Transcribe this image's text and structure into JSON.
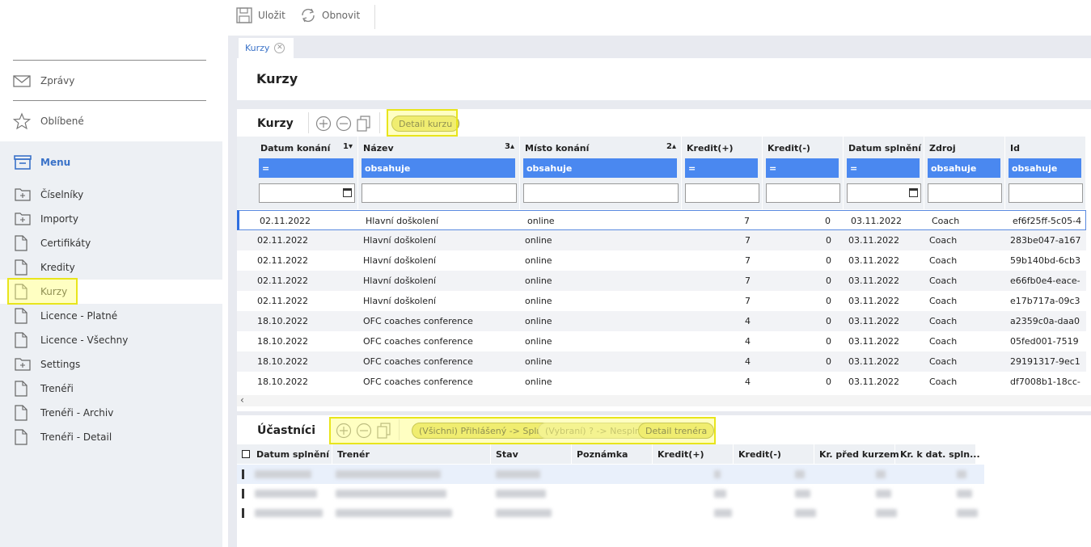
{
  "toolbar": {
    "save_label": "Uložit",
    "refresh_label": "Obnovit"
  },
  "sidebar": {
    "messages": "Zprávy",
    "favorites": "Oblíbené",
    "menu_title": "Menu",
    "items": [
      {
        "label": "Číselníky",
        "type": "folder"
      },
      {
        "label": "Importy",
        "type": "folder"
      },
      {
        "label": "Certifikáty",
        "type": "doc"
      },
      {
        "label": "Kredity",
        "type": "doc"
      },
      {
        "label": "Kurzy",
        "type": "doc",
        "active": true
      },
      {
        "label": "Licence - Platné",
        "type": "doc"
      },
      {
        "label": "Licence - Všechny",
        "type": "doc"
      },
      {
        "label": "Settings",
        "type": "folder"
      },
      {
        "label": "Trenéři",
        "type": "doc"
      },
      {
        "label": "Trenéři - Archiv",
        "type": "doc"
      },
      {
        "label": "Trenéři - Detail",
        "type": "doc"
      }
    ]
  },
  "tabs": [
    {
      "label": "Kurzy"
    }
  ],
  "page": {
    "title": "Kurzy"
  },
  "courses": {
    "title": "Kurzy",
    "detail_button": "Detail kurzu",
    "columns": [
      {
        "label": "Datum konání",
        "sort": "1▾",
        "op": "=",
        "cal": true
      },
      {
        "label": "Název",
        "sort": "3▴",
        "op": "obsahuje"
      },
      {
        "label": "Místo konání",
        "sort": "2▴",
        "op": "obsahuje"
      },
      {
        "label": "Kredit(+)",
        "op": "="
      },
      {
        "label": "Kredit(-)",
        "op": "="
      },
      {
        "label": "Datum splnění",
        "op": "=",
        "cal": true
      },
      {
        "label": "Zdroj",
        "op": "obsahuje"
      },
      {
        "label": "Id",
        "op": "obsahuje"
      }
    ],
    "rows": [
      [
        "02.11.2022",
        "Hlavní doškolení",
        "online",
        "7",
        "0",
        "03.11.2022",
        "Coach",
        "ef6f25ff-5c05-4"
      ],
      [
        "02.11.2022",
        "Hlavní doškolení",
        "online",
        "7",
        "0",
        "03.11.2022",
        "Coach",
        "283be047-a167"
      ],
      [
        "02.11.2022",
        "Hlavní doškolení",
        "online",
        "7",
        "0",
        "03.11.2022",
        "Coach",
        "59b140bd-6cb3"
      ],
      [
        "02.11.2022",
        "Hlavní doškolení",
        "online",
        "7",
        "0",
        "03.11.2022",
        "Coach",
        "e66fb0e4-eace-"
      ],
      [
        "02.11.2022",
        "Hlavní doškolení",
        "online",
        "7",
        "0",
        "03.11.2022",
        "Coach",
        "e17b717a-09c3"
      ],
      [
        "18.10.2022",
        "OFC coaches conference",
        "online",
        "4",
        "0",
        "03.11.2022",
        "Coach",
        "a2359c0a-daa0"
      ],
      [
        "18.10.2022",
        "OFC coaches conference",
        "online",
        "4",
        "0",
        "03.11.2022",
        "Coach",
        "05fed001-7519"
      ],
      [
        "18.10.2022",
        "OFC coaches conference",
        "online",
        "4",
        "0",
        "03.11.2022",
        "Coach",
        "29191317-9ec1"
      ],
      [
        "18.10.2022",
        "OFC coaches conference",
        "online",
        "4",
        "0",
        "03.11.2022",
        "Coach",
        "df7008b1-18cc-"
      ]
    ]
  },
  "participants": {
    "title": "Účastníci",
    "btn_all": "(Všichni) Přihlášený -> Splnil",
    "btn_selected": "(Vybraní) ? -> Nesplnil",
    "btn_detail": "Detail trenéra",
    "columns": [
      "Datum splnění",
      "Trenér",
      "Stav",
      "Poznámka",
      "Kredit(+)",
      "Kredit(-)",
      "Kr. před kurzem",
      "Kr. k dat. spln..."
    ]
  }
}
